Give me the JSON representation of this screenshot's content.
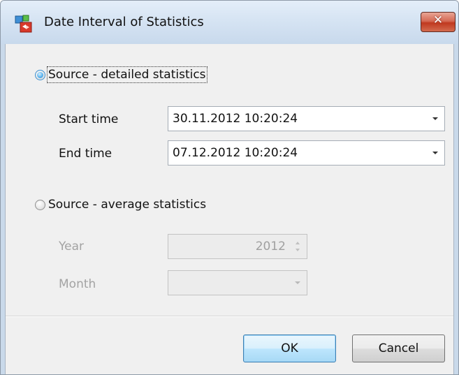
{
  "window": {
    "title": "Date Interval of Statistics",
    "close_label": "✕"
  },
  "options": {
    "detailed": {
      "label": "Source - detailed statistics",
      "checked": true
    },
    "average": {
      "label": "Source - average statistics",
      "checked": false
    }
  },
  "fields": {
    "start_time": {
      "label": "Start time",
      "value": "30.11.2012 10:20:24"
    },
    "end_time": {
      "label": "End time",
      "value": "07.12.2012 10:20:24"
    },
    "year": {
      "label": "Year",
      "value": "2012"
    },
    "month": {
      "label": "Month",
      "value": ""
    }
  },
  "buttons": {
    "ok": "OK",
    "cancel": "Cancel"
  },
  "colors": {
    "titlebar": "#d6e4f3",
    "close_button": "#c0391f",
    "client_background": "#f0f0f0",
    "radio_selected": "#2b86cf",
    "disabled_text": "#a3a3a3"
  },
  "icons": {
    "app": "app-icon",
    "close": "close-icon",
    "dropdown": "chevron-down-icon",
    "spin": "spin-arrows-icon"
  }
}
